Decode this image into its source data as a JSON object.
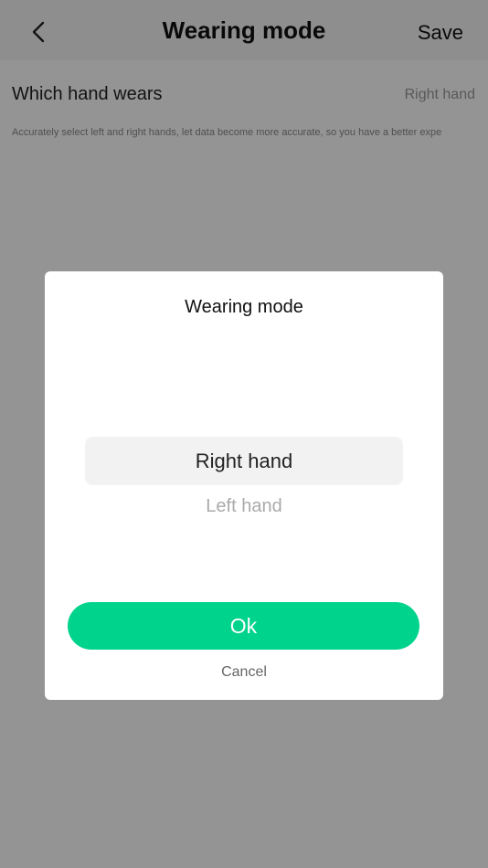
{
  "header": {
    "back_icon": "chevron-left-icon",
    "title": "Wearing mode",
    "save_label": "Save"
  },
  "setting": {
    "label": "Which hand wears",
    "value": "Right hand"
  },
  "hint": "Accurately select left and right hands, let data become more accurate, so you have a better expe",
  "dialog": {
    "title": "Wearing mode",
    "options": [
      "Right hand",
      "Left hand"
    ],
    "selected": "Right hand",
    "ok_label": "Ok",
    "cancel_label": "Cancel"
  },
  "colors": {
    "accent": "#00d38c",
    "overlay": "rgba(0,0,0,0.42)"
  }
}
